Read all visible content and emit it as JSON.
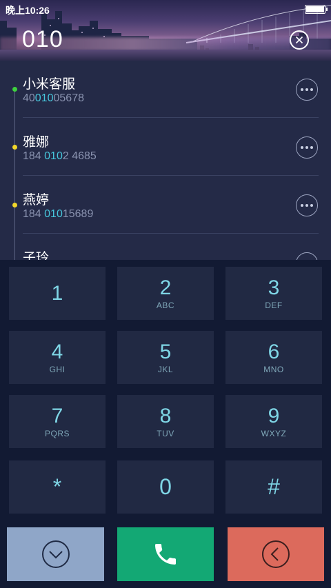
{
  "status_bar": {
    "time": "晚上10:26"
  },
  "dialer": {
    "input": "010"
  },
  "contacts": [
    {
      "name": "小米客服",
      "number_pre": "40",
      "number_match": "010",
      "number_post": "05678",
      "dot_color": "#3ed13e"
    },
    {
      "name": "雅娜",
      "number_pre": "184 ",
      "number_match": "010",
      "number_post": "2 4685",
      "dot_color": "#f2d72a"
    },
    {
      "name": "燕婷",
      "number_pre": "184 ",
      "number_match": "010",
      "number_post": "15689",
      "dot_color": "#f2d72a"
    },
    {
      "name": "子玲",
      "number_pre": "",
      "number_match": "",
      "number_post": "",
      "dot_color": "#f2d72a"
    }
  ],
  "keypad": {
    "keys": [
      {
        "digit": "1",
        "letters": ""
      },
      {
        "digit": "2",
        "letters": "ABC"
      },
      {
        "digit": "3",
        "letters": "DEF"
      },
      {
        "digit": "4",
        "letters": "GHI"
      },
      {
        "digit": "5",
        "letters": "JKL"
      },
      {
        "digit": "6",
        "letters": "MNO"
      },
      {
        "digit": "7",
        "letters": "PQRS"
      },
      {
        "digit": "8",
        "letters": "TUV"
      },
      {
        "digit": "9",
        "letters": "WXYZ"
      },
      {
        "digit": "*",
        "letters": ""
      },
      {
        "digit": "0",
        "letters": ""
      },
      {
        "digit": "#",
        "letters": ""
      }
    ]
  },
  "actions": {
    "collapse_icon": "chevron-down-circle-icon",
    "call_icon": "phone-icon",
    "back_icon": "chevron-left-circle-icon"
  },
  "colors": {
    "accent": "#47c6dc",
    "call": "#13a874",
    "delete": "#dc6a5c",
    "collapse": "#8fa6c8"
  }
}
